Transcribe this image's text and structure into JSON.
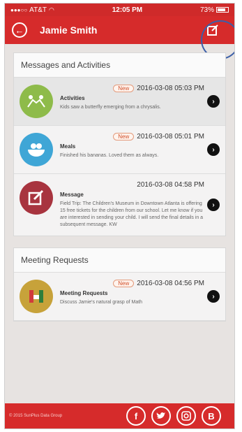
{
  "status_bar": {
    "carrier": "AT&T",
    "time": "12:05 PM",
    "battery": "73%"
  },
  "header": {
    "title": "Jamie Smith"
  },
  "messages_section": {
    "title": "Messages and Activities",
    "items": [
      {
        "badge": "New",
        "datetime": "2016-03-08 05:03 PM",
        "title": "Activities",
        "text": "Kids saw a butterfly emerging from a chrysalis.",
        "icon": "activities-icon",
        "icon_color": "#8ebb4a"
      },
      {
        "badge": "New",
        "datetime": "2016-03-08 05:01 PM",
        "title": "Meals",
        "text": "Finished his bananas. Loved them as always.",
        "icon": "meals-icon",
        "icon_color": "#3fa6d6"
      },
      {
        "badge": "",
        "datetime": "2016-03-08 04:58 PM",
        "title": "Message",
        "text": "Field Trip: The Children's Museum in Downtown Atlanta is offering 15 free tickets for the children from our school. Let me know if you are interested in sending your child. I will send the final details in a subsequent message. KW",
        "icon": "message-edit-icon",
        "icon_color": "#a8343f"
      }
    ]
  },
  "meeting_section": {
    "title": "Meeting Requests",
    "items": [
      {
        "badge": "New",
        "datetime": "2016-03-08 04:56 PM",
        "title": "Meeting Requests",
        "text": "Discuss Jamie's natural grasp of Math",
        "icon": "meeting-icon",
        "icon_color": "#c7a23a"
      }
    ]
  },
  "footer": {
    "copyright": "© 2015 SunPlus Data Group",
    "social": [
      "facebook-icon",
      "twitter-icon",
      "instagram-icon",
      "blogger-icon"
    ]
  },
  "colors": {
    "brand_red": "#d62b2b",
    "badge_orange": "#d14f2a"
  }
}
